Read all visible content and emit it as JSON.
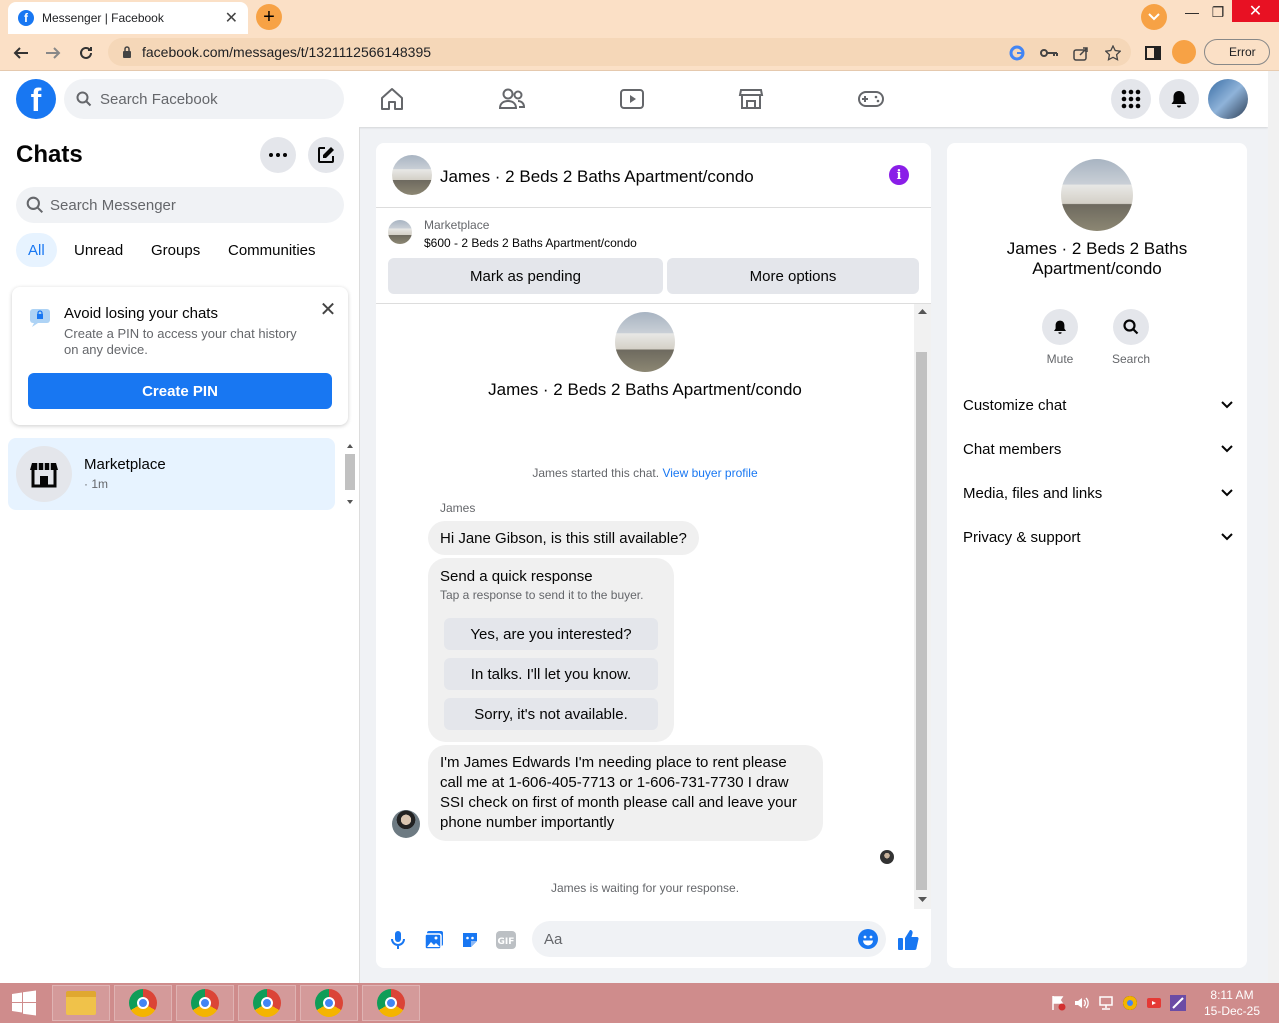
{
  "browser": {
    "tab_title": "Messenger | Facebook",
    "url": "facebook.com/messages/t/1321112566148395",
    "error_label": "Error"
  },
  "fb": {
    "search_placeholder": "Search Facebook"
  },
  "left": {
    "title": "Chats",
    "search_placeholder": "Search Messenger",
    "filters": [
      "All",
      "Unread",
      "Groups",
      "Communities"
    ],
    "pin_card": {
      "title": "Avoid losing your chats",
      "subtitle": "Create a PIN to access your chat history on any device.",
      "button": "Create PIN"
    },
    "chats": [
      {
        "name": "Marketplace",
        "time": "· 1m"
      }
    ]
  },
  "conversation": {
    "title": "James · 2 Beds 2 Baths Apartment/condo",
    "marketplace_label": "Marketplace",
    "listing": "$600 - 2 Beds 2 Baths Apartment/condo",
    "mark_pending": "Mark as pending",
    "more_options": "More options",
    "started_text": "James started this chat.",
    "view_buyer": "View buyer profile",
    "sender": "James",
    "message1": "Hi Jane Gibson, is this still available?",
    "quick_title": "Send a quick response",
    "quick_sub": "Tap a response to send it to the buyer.",
    "quick_options": [
      "Yes, are you interested?",
      "In talks. I'll let you know.",
      "Sorry, it's not available."
    ],
    "message2": "I'm James Edwards I'm needing place to rent please call me at 1-606-405-7713 or 1-606-731-7730 I draw SSI check on first of month please call and leave your phone number importantly",
    "waiting": "James is waiting for your response.",
    "composer_placeholder": "Aa"
  },
  "details": {
    "title": "James · 2 Beds 2 Baths Apartment/condo",
    "mute": "Mute",
    "search": "Search",
    "sections": [
      "Customize chat",
      "Chat members",
      "Media, files and links",
      "Privacy & support"
    ]
  },
  "taskbar": {
    "time": "8:11 AM",
    "date": "15-Dec-25"
  },
  "colors": {
    "accent": "#1877f2",
    "info_purple": "#8a1ee8",
    "chrome_tab_bg": "#fbe0c6",
    "taskbar": "#cf8c8c"
  }
}
